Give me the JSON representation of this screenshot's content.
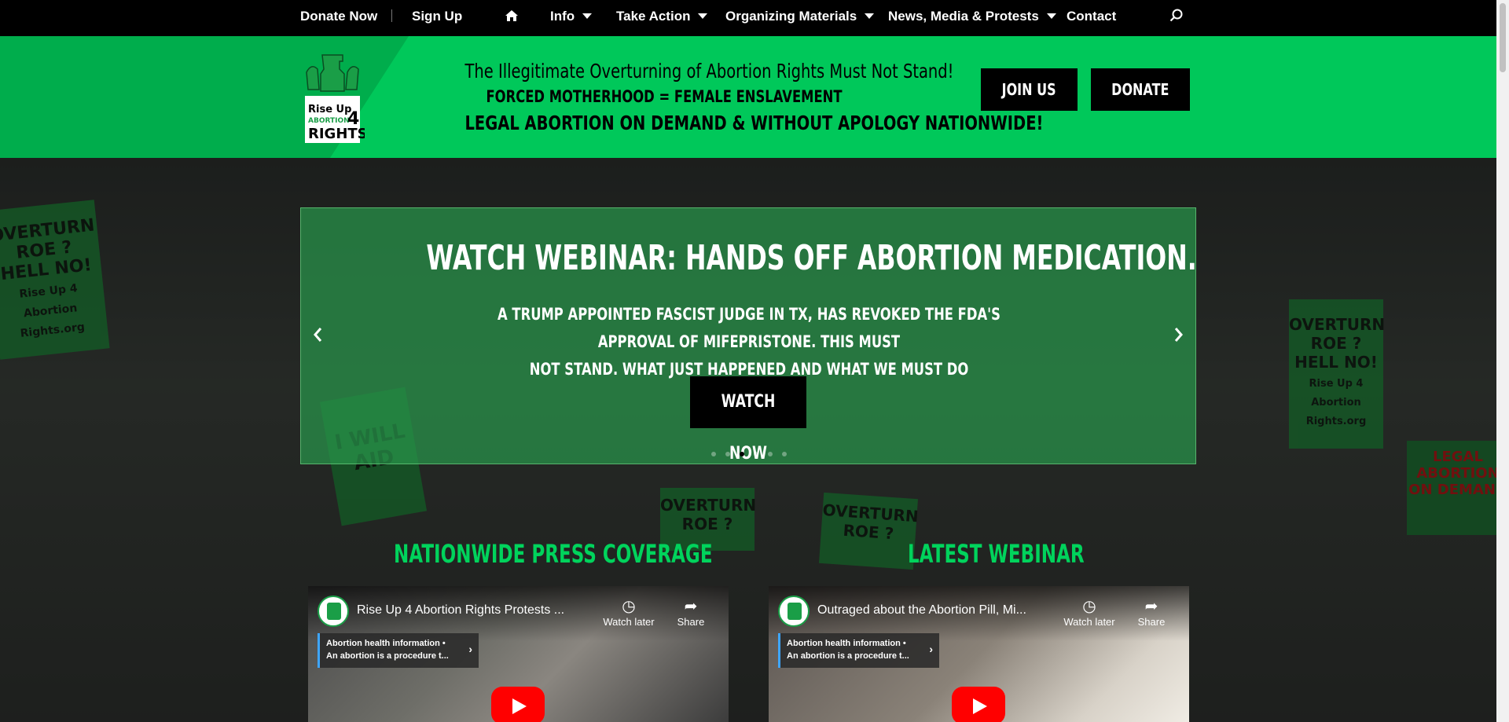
{
  "topnav": {
    "donate_now": "Donate Now",
    "sign_up": "Sign Up",
    "home_icon": "home-icon",
    "info": "Info",
    "take_action": "Take Action",
    "organizing_materials": "Organizing Materials",
    "news_media": "News, Media & Protests",
    "contact": "Contact",
    "search_icon": "search-icon"
  },
  "banner": {
    "logo_text": "Rise Up 4 Abortion Rights",
    "line1": "The Illegitimate Overturning of Abortion Rights Must Not Stand!",
    "line2": "FORCED MOTHERHOOD = FEMALE ENSLAVEMENT",
    "line3": "LEGAL ABORTION ON DEMAND & WITHOUT APOLOGY NATIONWIDE!",
    "join_us": "JOIN US",
    "donate": "DONATE"
  },
  "slider": {
    "title": "WATCH WEBINAR: HANDS OFF ABORTION MEDICATION.",
    "subtitle_line1": "A TRUMP APPOINTED FASCIST JUDGE IN TX, HAS REVOKED THE FDA'S APPROVAL OF MIFEPRISTONE. THIS MUST",
    "subtitle_line2": "NOT STAND. WHAT JUST HAPPENED AND WHAT WE MUST DO",
    "button": "WATCH NOW",
    "prev_icon": "chevron-left-icon",
    "next_icon": "chevron-right-icon",
    "slide_count": 6,
    "active_slide": 3
  },
  "sections": {
    "press": "NATIONWIDE PRESS COVERAGE",
    "webinar": "LATEST WEBINAR"
  },
  "videos": [
    {
      "title": "Rise Up 4 Abortion Rights Protests ...",
      "watch_later": "Watch later",
      "share": "Share",
      "info_line1": "Abortion health information •",
      "info_line2": "An abortion is a procedure t..."
    },
    {
      "title": "Outraged about the Abortion Pill, Mi...",
      "watch_later": "Watch later",
      "share": "Share",
      "info_line1": "Abortion health information •",
      "info_line2": "An abortion is a procedure t..."
    }
  ],
  "hero_signs": [
    "OVERTURN ROE ? HELL NO!",
    "Rise Up 4 Abortion Rights.org",
    "I WILL AID",
    "OVERTURN ROE ?",
    "LEGAL ABORTION ON DEMAND"
  ],
  "colors": {
    "brand_green": "#00c85a",
    "accent_green": "#00d35c",
    "black": "#000000"
  }
}
